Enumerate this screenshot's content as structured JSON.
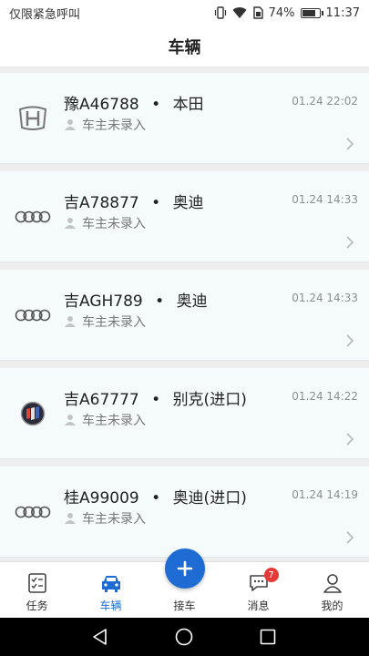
{
  "status_bar": {
    "carrier_text": "仅限紧急呼叫",
    "battery_text": "74%",
    "time": "11:37"
  },
  "header": {
    "title": "车辆"
  },
  "vehicles": [
    {
      "plate": "豫A46788",
      "brand": "本田",
      "time": "01.24 22:02",
      "owner": "车主未录入",
      "logo": "honda-logo"
    },
    {
      "plate": "吉A78877",
      "brand": "奥迪",
      "time": "01.24 14:33",
      "owner": "车主未录入",
      "logo": "audi-logo"
    },
    {
      "plate": "吉AGH789",
      "brand": "奥迪",
      "time": "01.24 14:33",
      "owner": "车主未录入",
      "logo": "audi-logo"
    },
    {
      "plate": "吉A67777",
      "brand": "别克(进口)",
      "time": "01.24 14:22",
      "owner": "车主未录入",
      "logo": "buick-logo"
    },
    {
      "plate": "桂A99009",
      "brand": "奥迪(进口)",
      "time": "01.24 14:19",
      "owner": "车主未录入",
      "logo": "audi-logo"
    }
  ],
  "separator": "•",
  "tabbar": {
    "tabs": [
      {
        "label": "任务",
        "icon": "task-list-icon"
      },
      {
        "label": "车辆",
        "icon": "car-icon",
        "active": true
      },
      {
        "label": "接车",
        "icon": "plus-icon"
      },
      {
        "label": "消息",
        "icon": "message-icon",
        "badge": "7"
      },
      {
        "label": "我的",
        "icon": "profile-icon"
      }
    ]
  },
  "colors": {
    "accent": "#1d6bd3",
    "badge": "#e53935",
    "card_bg": "#f5fbfb"
  }
}
